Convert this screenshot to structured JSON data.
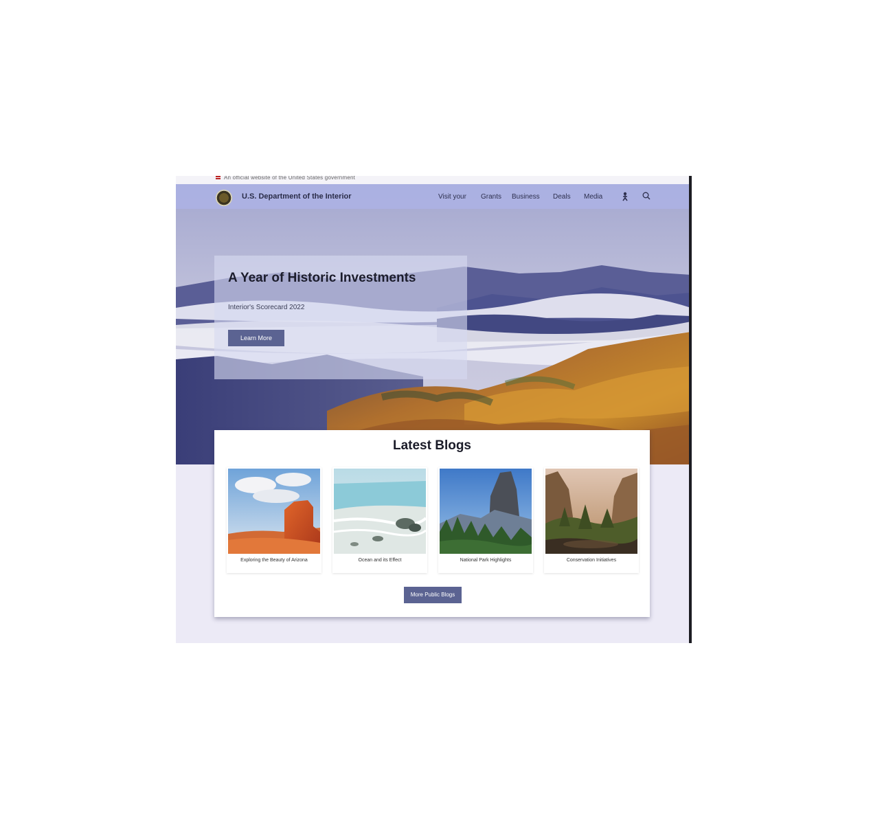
{
  "gov_banner": {
    "text": "An official website of the United States government"
  },
  "header": {
    "site_title": "U.S. Department of the Interior",
    "nav": [
      "Visit your",
      "Grants",
      "Business",
      "Deals",
      "Media"
    ]
  },
  "hero": {
    "title": "A Year of Historic Investments",
    "subtitle": "Interior's Scorecard 2022",
    "button_label": "Learn More"
  },
  "blogs": {
    "heading": "Latest Blogs",
    "items": [
      {
        "label": "Exploring the Beauty of Arizona",
        "image": "red-rock-butte"
      },
      {
        "label": "Ocean and its Effect",
        "image": "coastline"
      },
      {
        "label": "National Park Highlights",
        "image": "granite-peak-forest"
      },
      {
        "label": "Conservation Initiatives",
        "image": "valley-cliffs"
      }
    ],
    "more_label": "More Public Blogs"
  },
  "colors": {
    "navbar": "#acb2e4",
    "accent_button": "#5b6392",
    "page_background": "#eceaf6"
  }
}
